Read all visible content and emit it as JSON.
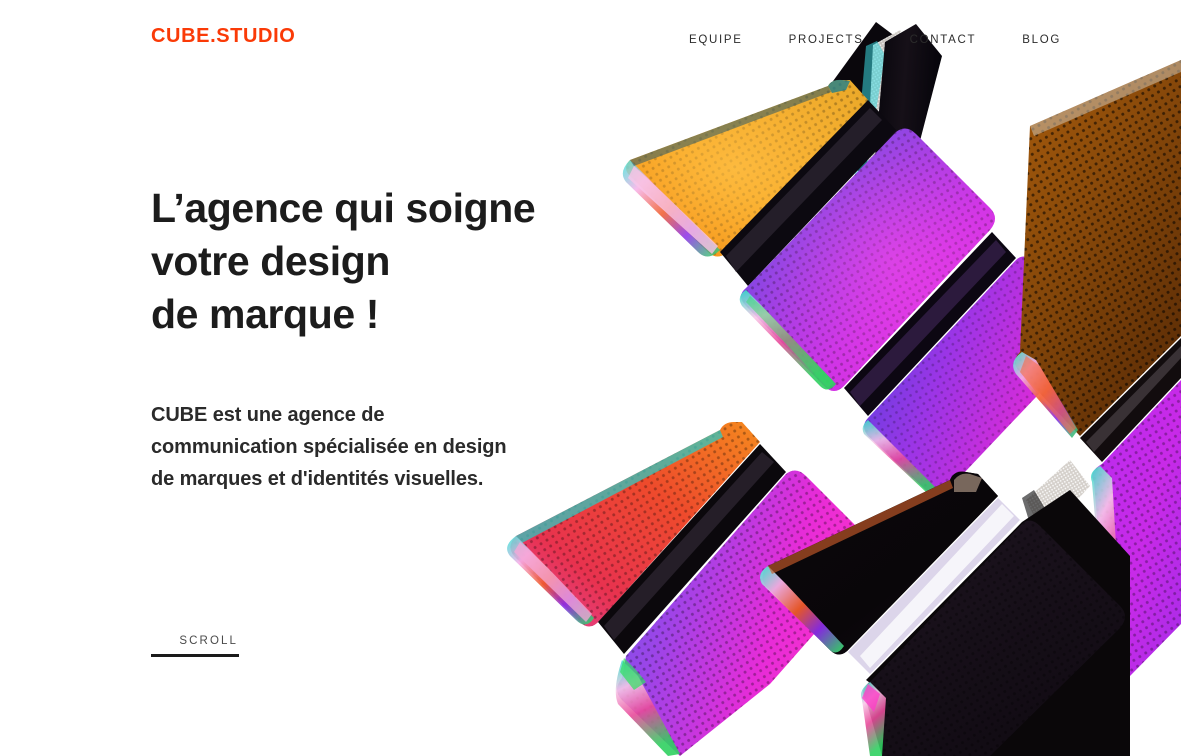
{
  "site": {
    "background_color": "#ffffff",
    "logo_text": "CUBE.STUDIO",
    "logo_color": "#FA3A07"
  },
  "header": {
    "nav": [
      {
        "label": "EQUIPE"
      },
      {
        "label": "PROJECTS"
      },
      {
        "label": "CONTACT"
      },
      {
        "label": "BLOG"
      }
    ],
    "nav_color": "#2b2b2b"
  },
  "hero": {
    "headline": "L’agence qui soigne\nvotre design\nde marque !",
    "headline_color": "#1c1c1c",
    "subcopy": "CUBE est une agence de\ncommunication spécialisée en design\nde marques et d'identités visuelles.",
    "subcopy_color": "#2a2a2a",
    "scroll_label": "SCROLL",
    "scroll_color": "#4a4a4a"
  },
  "artwork": {
    "description": "Iridescent perforated 3D cubes arranged diagonally on white",
    "palette": {
      "orange": "#F59A15",
      "amber": "#E8880A",
      "magenta": "#F02CE0",
      "violet": "#8B3BE8",
      "blue": "#5B4BE0",
      "indigo": "#4438C8",
      "red": "#E8253C",
      "pink": "#FF4FD0",
      "dark": "#0a0709",
      "near_black": "#120d12",
      "brown": "#7A4208",
      "silver": "#d8d4d0",
      "cyan_edge": "#35E8E0",
      "green_edge": "#2FE04A"
    }
  }
}
